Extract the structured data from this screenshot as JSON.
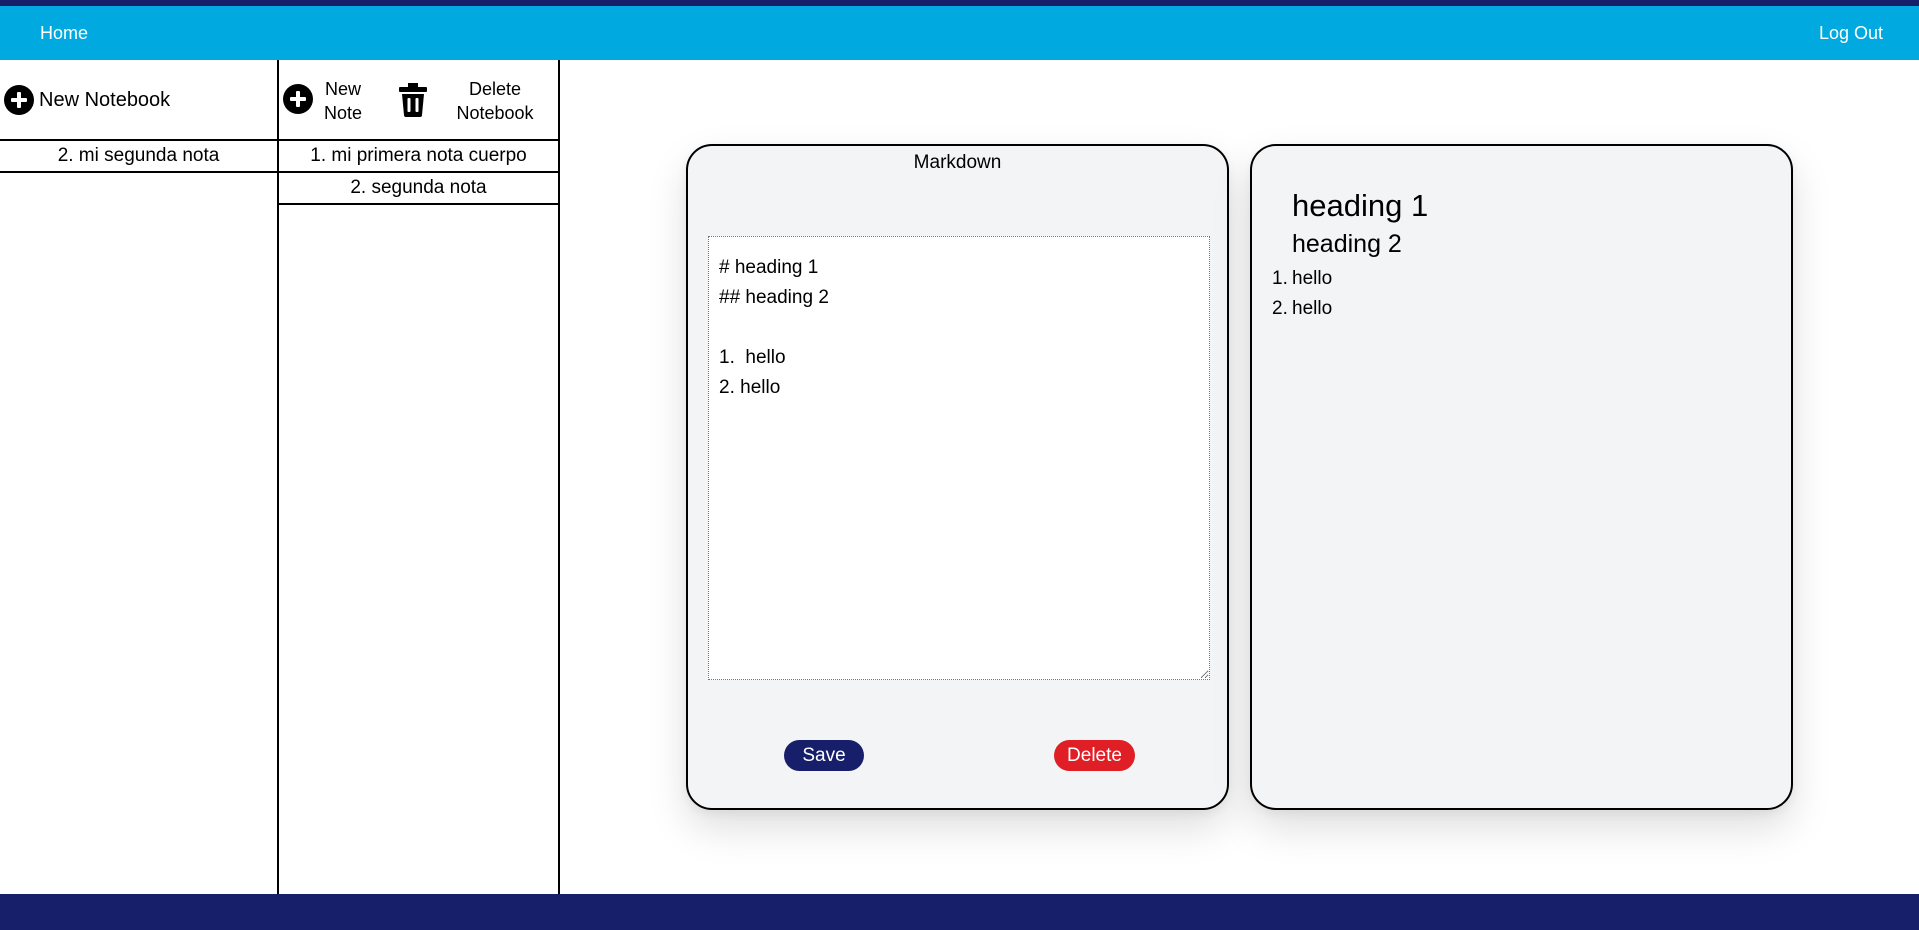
{
  "nav": {
    "home": "Home",
    "logout": "Log Out"
  },
  "notebooks": {
    "new_label": "New Notebook",
    "items": [
      "2. mi segunda nota"
    ]
  },
  "notes": {
    "new_label_line1": "New",
    "new_label_line2": "Note",
    "delete_label_line1": "Delete",
    "delete_label_line2": "Notebook",
    "items": [
      "1. mi primera nota cuerpo",
      "2. segunda nota"
    ]
  },
  "editor": {
    "title": "Markdown",
    "content": "# heading 1\n## heading 2\n\n1.  hello\n2. hello",
    "save_label": "Save",
    "delete_label": "Delete"
  },
  "preview": {
    "h1": "heading 1",
    "h2": "heading 2",
    "list": [
      {
        "num": "1.",
        "text": "hello"
      },
      {
        "num": "2.",
        "text": "hello"
      }
    ]
  },
  "colors": {
    "navbar": "#00aae0",
    "dark_navy": "#171f6a",
    "delete_red": "#df1e26",
    "card_bg": "#f3f4f6"
  }
}
